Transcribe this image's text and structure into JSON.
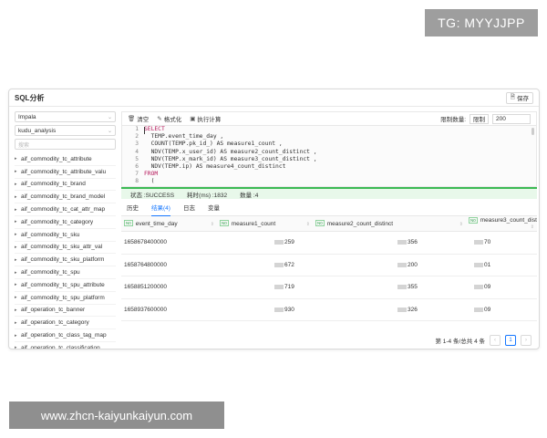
{
  "badge": "TG: MYYJJPP",
  "watermark": "www.zhcn-kaiyunkaiyun.com",
  "window": {
    "title": "SQL分析",
    "save_label": "保存"
  },
  "sidebar": {
    "engine": "Impala",
    "database": "kudu_analysis",
    "search_placeholder": "搜索",
    "tables": [
      "aif_commodity_tc_attribute",
      "aif_commodity_tc_attribute_valu",
      "aif_commodity_tc_brand",
      "aif_commodity_tc_brand_model",
      "aif_commodity_tc_cat_attr_map",
      "aif_commodity_tc_category",
      "aif_commodity_tc_sku",
      "aif_commodity_tc_sku_attr_val",
      "aif_commodity_tc_sku_platform",
      "aif_commodity_tc_spu",
      "aif_commodity_tc_spu_attribute",
      "aif_commodity_tc_spu_platform",
      "aif_operation_tc_banner",
      "aif_operation_tc_category",
      "aif_operation_tc_class_tag_map",
      "aif_operation_tc_classification",
      "aif_operation_tc_corner_mark"
    ]
  },
  "toolbar": {
    "clear": "清空",
    "format": "格式化",
    "run": "执行计算",
    "limit_label": "限制数量:",
    "limit_mode": "限制",
    "limit_value": "200"
  },
  "editor": {
    "lines": [
      {
        "n": "1",
        "kw": "SELECT",
        "rest": ""
      },
      {
        "n": "2",
        "kw": "",
        "rest": "  TEMP.event_time_day ,"
      },
      {
        "n": "3",
        "kw": "",
        "rest": "  COUNT(TEMP.pk_id_) AS measure1_count ,"
      },
      {
        "n": "4",
        "kw": "",
        "rest": "  NDV(TEMP.x_user_id) AS measure2_count_distinct ,"
      },
      {
        "n": "5",
        "kw": "",
        "rest": "  NDV(TEMP.x_mark_id) AS measure3_count_distinct ,"
      },
      {
        "n": "6",
        "kw": "",
        "rest": "  NDV(TEMP.ip) AS measure4_count_distinct"
      },
      {
        "n": "7",
        "kw": "FROM",
        "rest": ""
      },
      {
        "n": "8",
        "kw": "",
        "rest": "  ("
      }
    ]
  },
  "status": {
    "state": "状态 :SUCCESS",
    "time": "耗时(ms) :1832",
    "count": "数量 :4"
  },
  "tabs": {
    "history": "历史",
    "result": "结果(4)",
    "log": "日志",
    "vars": "变量"
  },
  "result": {
    "columns": [
      "event_time_day",
      "measure1_count",
      "measure2_count_distinct",
      "measure3_count_dist"
    ],
    "rows": [
      [
        "1658678400000",
        "259",
        "356",
        "70"
      ],
      [
        "1658764800000",
        "672",
        "200",
        "01"
      ],
      [
        "1658851200000",
        "719",
        "355",
        "09"
      ],
      [
        "1658937600000",
        "930",
        "326",
        "09"
      ]
    ]
  },
  "pager": {
    "summary": "第 1-4 条/总共 4 条",
    "prev": "‹",
    "page": "1",
    "next": "›"
  }
}
